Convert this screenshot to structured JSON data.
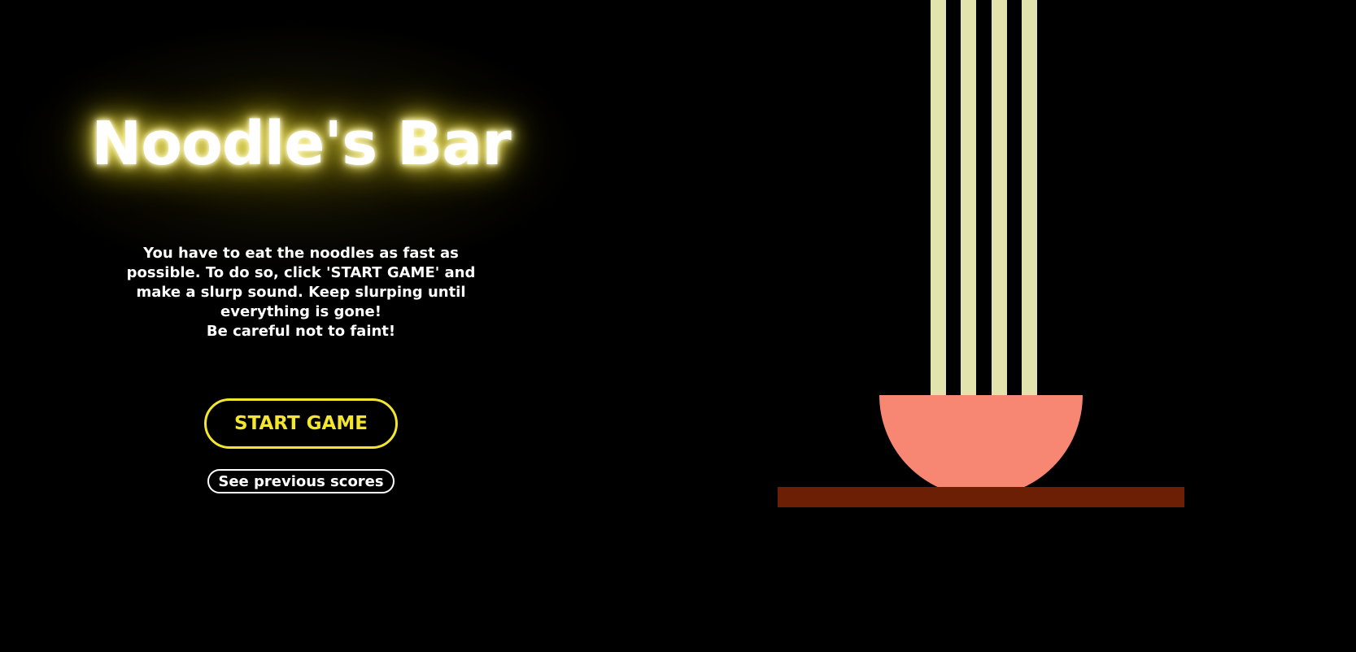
{
  "title": "Noodle's Bar",
  "instructions": {
    "main": "You have to eat the noodles as fast as possible. To do so, click 'START GAME' and make a slurp sound. Keep slurping until everything is gone!",
    "warning": "Be careful not to faint!"
  },
  "buttons": {
    "start_label": "START GAME",
    "scores_label": "See previous scores"
  },
  "scene": {
    "noodle_count": 4
  },
  "colors": {
    "background": "#000000",
    "title_glow": "#f2e45a",
    "start_button": "#f2e62e",
    "noodle": "#e3e4ad",
    "bowl": "#f78672",
    "table": "#6c1f04"
  }
}
